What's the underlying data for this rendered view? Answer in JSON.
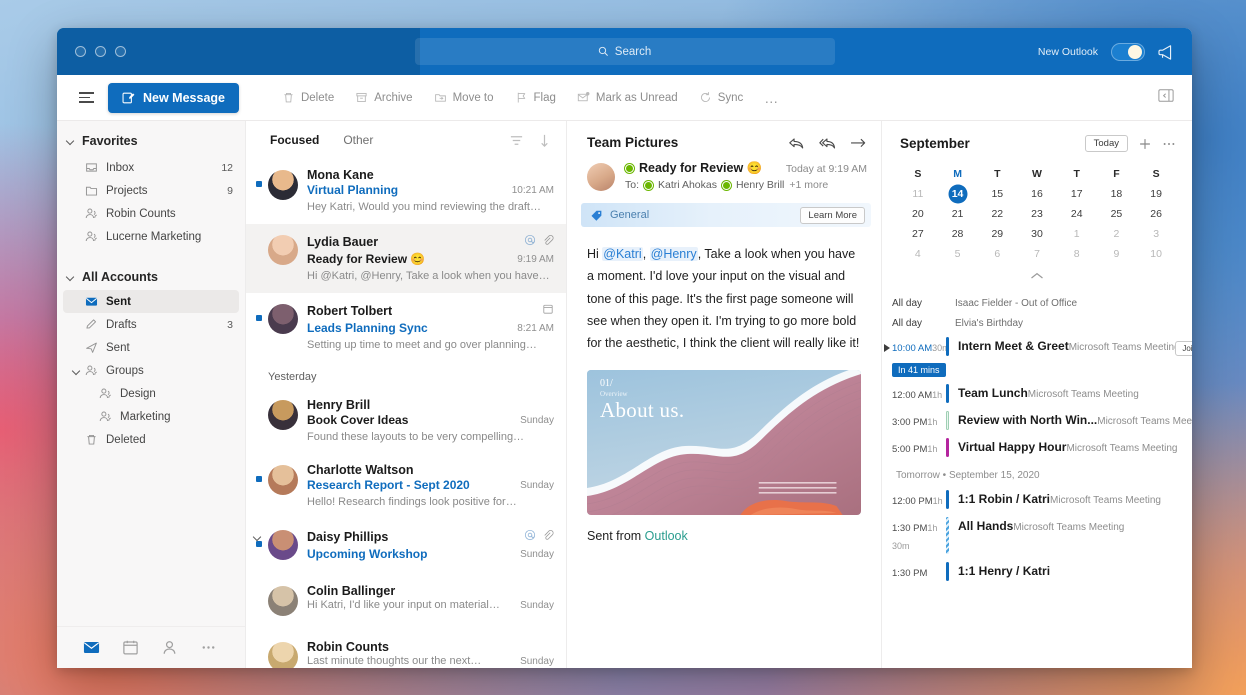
{
  "titlebar": {
    "search_placeholder": "Search",
    "new_outlook_label": "New Outlook",
    "toggle_state": "on"
  },
  "commandbar": {
    "new_message": "New Message",
    "items": [
      {
        "label": "Delete",
        "icon": "trash-icon"
      },
      {
        "label": "Archive",
        "icon": "archive-icon"
      },
      {
        "label": "Move to",
        "icon": "folder-arrow-icon"
      },
      {
        "label": "Flag",
        "icon": "flag-icon"
      },
      {
        "label": "Mark as Unread",
        "icon": "envelope-unread-icon"
      },
      {
        "label": "Sync",
        "icon": "sync-icon"
      }
    ],
    "overflow": "…"
  },
  "sidebar": {
    "groups": [
      {
        "title": "Favorites",
        "items": [
          {
            "label": "Inbox",
            "icon": "inbox-icon",
            "count": "12",
            "active": false,
            "sub": false
          },
          {
            "label": "Projects",
            "icon": "folder-icon",
            "count": "9",
            "active": false,
            "sub": false
          },
          {
            "label": "Robin Counts",
            "icon": "people-icon",
            "count": "",
            "active": false,
            "sub": false
          },
          {
            "label": "Lucerne Marketing",
            "icon": "people-icon",
            "count": "",
            "active": false,
            "sub": false
          }
        ]
      },
      {
        "title": "All Accounts",
        "items": [
          {
            "label": "Sent",
            "icon": "sent-icon",
            "count": "",
            "active": true,
            "sub": false
          },
          {
            "label": "Drafts",
            "icon": "drafts-icon",
            "count": "3",
            "active": false,
            "sub": false
          },
          {
            "label": "Sent",
            "icon": "sent-outline-icon",
            "count": "",
            "active": false,
            "sub": false
          },
          {
            "label": "Groups",
            "icon": "people-icon",
            "count": "",
            "active": false,
            "sub": false,
            "expandable": true
          },
          {
            "label": "Design",
            "icon": "people-icon",
            "count": "",
            "active": false,
            "sub": true
          },
          {
            "label": "Marketing",
            "icon": "people-icon",
            "count": "",
            "active": false,
            "sub": true
          },
          {
            "label": "Deleted",
            "icon": "trash-icon",
            "count": "",
            "active": false,
            "sub": false
          }
        ]
      }
    ],
    "bottom_nav": [
      {
        "name": "mail-icon",
        "active": true
      },
      {
        "name": "calendar-icon",
        "active": false
      },
      {
        "name": "people-icon",
        "active": false
      },
      {
        "name": "more-icon",
        "active": false
      }
    ]
  },
  "messagelist": {
    "tabs": [
      {
        "label": "Focused",
        "active": true
      },
      {
        "label": "Other",
        "active": false
      }
    ],
    "day_label": "Yesterday",
    "messages": [
      {
        "sender": "Mona Kane",
        "subject": "Virtual Planning",
        "time": "10:21 AM",
        "preview": "Hey Katri, Would you mind reviewing the draft…",
        "unread": true,
        "selected": false,
        "subject_link": true,
        "avatar": "#2b2b35",
        "avatar2": "#e8b98c",
        "icons": []
      },
      {
        "sender": "Lydia Bauer",
        "subject": "Ready for Review 😊",
        "time": "9:19 AM",
        "preview": "Hi @Katri, @Henry, Take a look when you have…",
        "unread": false,
        "selected": true,
        "subject_link": false,
        "avatar": "#d8a989",
        "avatar2": "#f2cdb2",
        "icons": [
          "mention-icon",
          "attachment-icon"
        ]
      },
      {
        "sender": "Robert Tolbert",
        "subject": "Leads Planning Sync",
        "time": "8:21 AM",
        "preview": "Setting up time to meet and go over planning…",
        "unread": true,
        "selected": false,
        "subject_link": true,
        "avatar": "#4a3b4e",
        "avatar2": "#7d5f6e",
        "icons": [
          "calendar-event-icon"
        ]
      },
      {
        "sender": "Henry Brill",
        "subject": "Book Cover Ideas",
        "time": "Sunday",
        "preview": "Found these layouts to be very compelling…",
        "unread": false,
        "selected": false,
        "subject_link": false,
        "avatar": "#38303a",
        "avatar2": "#c79a5e",
        "icons": []
      },
      {
        "sender": "Charlotte Waltson",
        "subject": "Research Report - Sept 2020",
        "time": "Sunday",
        "preview": "Hello! Research findings look positive for…",
        "unread": true,
        "selected": false,
        "subject_link": true,
        "avatar": "#b57a5a",
        "avatar2": "#e5c09a",
        "icons": []
      },
      {
        "sender": "Daisy Phillips",
        "subject": "Upcoming Workshop",
        "time": "Sunday",
        "preview": "",
        "unread": true,
        "selected": false,
        "subject_link": true,
        "avatar": "#6a4a8a",
        "avatar2": "#c98f74",
        "icons": [
          "mention-icon",
          "attachment-icon"
        ],
        "expandable": true
      },
      {
        "sender": "Colin Ballinger",
        "subject": "",
        "time": "Sunday",
        "preview": "Hi Katri, I'd like your input on material…",
        "unread": false,
        "selected": false,
        "subject_link": false,
        "avatar": "#8b8176",
        "avatar2": "#d6c3a8",
        "icons": []
      },
      {
        "sender": "Robin Counts",
        "subject": "",
        "time": "Sunday",
        "preview": "Last minute thoughts our the next…",
        "unread": false,
        "selected": false,
        "subject_link": false,
        "avatar": "#c8a96f",
        "avatar2": "#edd5ad",
        "icons": []
      }
    ]
  },
  "reading": {
    "title": "Team Pictures",
    "subject": "Ready for Review 😊",
    "timestamp": "Today at 9:19 AM",
    "to_label": "To:",
    "recipients": [
      "Katri Ahokas",
      "Henry Brill"
    ],
    "more_recipients": "+1 more",
    "banner_tag": "General",
    "banner_button": "Learn More",
    "body_prefix": "Hi ",
    "mention1": "@Katri",
    "body_mid": ", ",
    "mention2": "@Henry",
    "body_rest": ", Take a look when you have a moment. I'd love your input on the visual and tone of this page. It's the first page someone will see when they open it. I'm trying to go more bold for the aesthetic, I think the client will really like it!",
    "card_number": "01/",
    "card_sub": "Overview",
    "card_title": "About us.",
    "footer_prefix": "Sent from ",
    "footer_link": "Outlook"
  },
  "calendar": {
    "month": "September",
    "today_button": "Today",
    "dow": [
      "S",
      "M",
      "T",
      "W",
      "T",
      "F",
      "S"
    ],
    "weeks": [
      [
        {
          "d": "11",
          "muted": true
        },
        {
          "d": "14",
          "sel": true
        },
        {
          "d": "15"
        },
        {
          "d": "16"
        },
        {
          "d": "17"
        },
        {
          "d": "18"
        },
        {
          "d": "19"
        }
      ],
      [
        {
          "d": "20"
        },
        {
          "d": "21"
        },
        {
          "d": "22"
        },
        {
          "d": "23"
        },
        {
          "d": "24"
        },
        {
          "d": "25"
        },
        {
          "d": "26"
        }
      ],
      [
        {
          "d": "27"
        },
        {
          "d": "28"
        },
        {
          "d": "29"
        },
        {
          "d": "30"
        },
        {
          "d": "1",
          "muted": true
        },
        {
          "d": "2",
          "muted": true
        },
        {
          "d": "3",
          "muted": true
        }
      ],
      [
        {
          "d": "4",
          "muted": true
        },
        {
          "d": "5",
          "muted": true
        },
        {
          "d": "6",
          "muted": true
        },
        {
          "d": "7",
          "muted": true
        },
        {
          "d": "8",
          "muted": true
        },
        {
          "d": "9",
          "muted": true
        },
        {
          "d": "10",
          "muted": true
        }
      ]
    ],
    "allday": [
      {
        "time": "All day",
        "title": "Isaac Fielder - Out of Office"
      },
      {
        "time": "All day",
        "title": "Elvia's Birthday"
      }
    ],
    "in_mins_badge": "In 41 mins",
    "join_button": "Join",
    "tomorrow_label": "Tomorrow • September 15, 2020",
    "events": [
      {
        "time": "10:00 AM",
        "duration": "30m",
        "title": "Intern Meet & Greet",
        "sub": "Microsoft Teams Meeting",
        "color": "#0f6cbd",
        "current": true
      },
      {
        "time": "12:00 AM",
        "duration": "1h",
        "title": "Team Lunch",
        "sub": "Microsoft Teams Meeting",
        "color": "#0f6cbd"
      },
      {
        "time": "3:00 PM",
        "duration": "1h",
        "title": "Review with North Win...",
        "sub": "Microsoft Teams Meeting",
        "color": "#c8e6d4",
        "outline": true
      },
      {
        "time": "5:00 PM",
        "duration": "1h",
        "title": "Virtual Happy Hour",
        "sub": "Microsoft Teams Meeting",
        "color": "#b4259e"
      }
    ],
    "tomorrow_events": [
      {
        "time": "12:00 PM",
        "duration": "1h",
        "title": "1:1 Robin / Katri",
        "sub": "Microsoft Teams Meeting",
        "color": "#0f6cbd"
      },
      {
        "time": "1:30 PM",
        "duration": "1h 30m",
        "title": "All Hands",
        "sub": "Microsoft Teams Meeting",
        "color": "#4aa3df",
        "striped": true
      },
      {
        "time": "1:30 PM",
        "duration": "",
        "title": "1:1 Henry / Katri",
        "sub": "",
        "color": "#0f6cbd"
      }
    ]
  }
}
